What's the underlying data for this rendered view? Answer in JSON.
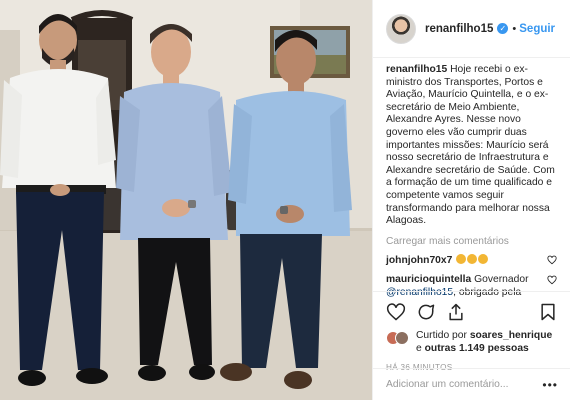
{
  "post": {
    "username": "renanfilho15",
    "verified_icon": "verified-badge-icon",
    "follow_label": "Seguir",
    "separator": "•"
  },
  "caption": {
    "author": "renanfilho15",
    "text": "Hoje recebi o ex-ministro dos Transportes, Portos e Aviação, Maurício Quintella, e o ex-secretário de Meio Ambiente, Alexandre Ayres. Nesse novo governo eles vão cumprir duas importantes missões: Maurício será nosso secretário de Infraestrutura e Alexandre secretário de Saúde. Com a formação de um time qualificado e competente vamos seguir transformando para melhorar nossa Alagoas."
  },
  "load_more_label": "Carregar mais comentários",
  "comments": [
    {
      "author": "johnjohn70x7",
      "text": "",
      "emoji_count": 3
    },
    {
      "author": "mauricioquintella",
      "text": "Governador",
      "mention": "@renanfilho15",
      "text_after": ", obrigado pela confiança! Sinto-me muito honrado em poder servir a Alagoas e fazer parte dessa equipe vencedora! Conte"
    }
  ],
  "likes": {
    "prefix": "Curtido por",
    "user": "soares_henrique",
    "connector": "e",
    "others": "outras 1.149 pessoas"
  },
  "timestamp": "HÁ 36 MINUTOS",
  "add_comment": {
    "placeholder": "Adicionar um comentário..."
  },
  "more_label": "•••",
  "colors": {
    "accent": "#3897f0",
    "text": "#262626",
    "muted": "#999999",
    "border": "#efefef"
  }
}
